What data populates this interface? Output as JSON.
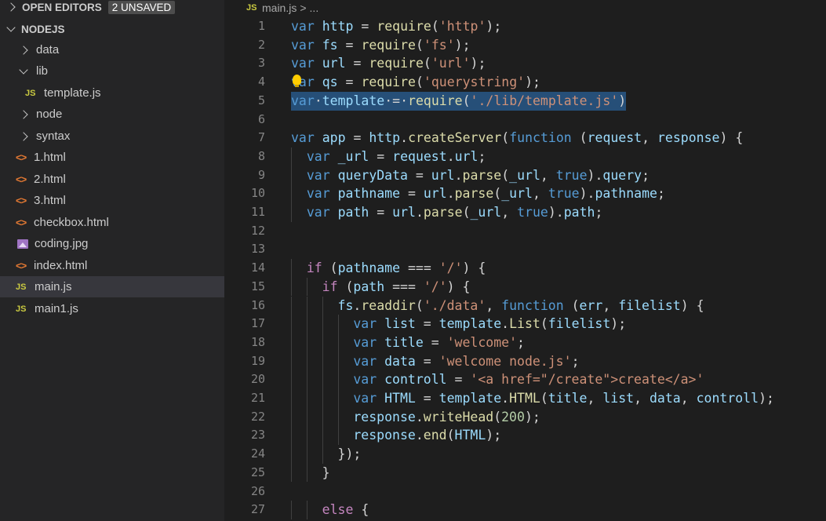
{
  "sidebar": {
    "open_editors": {
      "title": "OPEN EDITORS",
      "badge": "2 UNSAVED"
    },
    "folder": {
      "title": "NODEJS"
    },
    "items": [
      {
        "label": "data",
        "kind": "folder",
        "expanded": false
      },
      {
        "label": "lib",
        "kind": "folder",
        "expanded": true
      },
      {
        "label": "template.js",
        "kind": "js",
        "icon": "JS"
      },
      {
        "label": "node",
        "kind": "folder",
        "expanded": false
      },
      {
        "label": "syntax",
        "kind": "folder",
        "expanded": false
      },
      {
        "label": "1.html",
        "kind": "html",
        "icon": "<>"
      },
      {
        "label": "2.html",
        "kind": "html",
        "icon": "<>"
      },
      {
        "label": "3.html",
        "kind": "html",
        "icon": "<>"
      },
      {
        "label": "checkbox.html",
        "kind": "html",
        "icon": "<>"
      },
      {
        "label": "coding.jpg",
        "kind": "image"
      },
      {
        "label": "index.html",
        "kind": "html",
        "icon": "<>"
      },
      {
        "label": "main.js",
        "kind": "js",
        "icon": "JS",
        "selected": true
      },
      {
        "label": "main1.js",
        "kind": "js",
        "icon": "JS"
      }
    ]
  },
  "breadcrumb": {
    "icon": "JS",
    "file": "main.js",
    "separator": ">",
    "rest": "..."
  },
  "editor": {
    "lines": [
      {
        "n": "1",
        "tokens": [
          [
            "kw",
            "var"
          ],
          [
            "op",
            " "
          ],
          [
            "var",
            "http"
          ],
          [
            "op",
            " = "
          ],
          [
            "fn",
            "require"
          ],
          [
            "op",
            "("
          ],
          [
            "str",
            "'http'"
          ],
          [
            "op",
            ");"
          ]
        ]
      },
      {
        "n": "2",
        "tokens": [
          [
            "kw",
            "var"
          ],
          [
            "op",
            " "
          ],
          [
            "var",
            "fs"
          ],
          [
            "op",
            " = "
          ],
          [
            "fn",
            "require"
          ],
          [
            "op",
            "("
          ],
          [
            "str",
            "'fs'"
          ],
          [
            "op",
            ");"
          ]
        ]
      },
      {
        "n": "3",
        "tokens": [
          [
            "kw",
            "var"
          ],
          [
            "op",
            " "
          ],
          [
            "var",
            "url"
          ],
          [
            "op",
            " = "
          ],
          [
            "fn",
            "require"
          ],
          [
            "op",
            "("
          ],
          [
            "str",
            "'url'"
          ],
          [
            "op",
            ");"
          ]
        ]
      },
      {
        "n": "4",
        "tokens": [
          [
            "kw",
            "var"
          ],
          [
            "op",
            " "
          ],
          [
            "var",
            "qs"
          ],
          [
            "op",
            " = "
          ],
          [
            "fn",
            "require"
          ],
          [
            "op",
            "("
          ],
          [
            "str",
            "'querystring'"
          ],
          [
            "op",
            ");"
          ]
        ],
        "bulb": true
      },
      {
        "n": "5",
        "tokens": [
          [
            "kw",
            "var"
          ],
          [
            "op",
            "·"
          ],
          [
            "var",
            "template"
          ],
          [
            "op",
            "·=·"
          ],
          [
            "fn",
            "require"
          ],
          [
            "op",
            "("
          ],
          [
            "str",
            "'./lib/template.js'"
          ],
          [
            "op",
            ")"
          ]
        ],
        "selected": true
      },
      {
        "n": "6",
        "tokens": []
      },
      {
        "n": "7",
        "tokens": [
          [
            "kw",
            "var"
          ],
          [
            "op",
            " "
          ],
          [
            "var",
            "app"
          ],
          [
            "op",
            " = "
          ],
          [
            "var",
            "http"
          ],
          [
            "op",
            "."
          ],
          [
            "fn",
            "createServer"
          ],
          [
            "op",
            "("
          ],
          [
            "kw",
            "function"
          ],
          [
            "op",
            " ("
          ],
          [
            "var",
            "request"
          ],
          [
            "op",
            ", "
          ],
          [
            "var",
            "response"
          ],
          [
            "op",
            ") {"
          ]
        ]
      },
      {
        "n": "8",
        "indent": 1,
        "tokens": [
          [
            "kw",
            "var"
          ],
          [
            "op",
            " "
          ],
          [
            "var",
            "_url"
          ],
          [
            "op",
            " = "
          ],
          [
            "var",
            "request"
          ],
          [
            "op",
            "."
          ],
          [
            "var",
            "url"
          ],
          [
            "op",
            ";"
          ]
        ]
      },
      {
        "n": "9",
        "indent": 1,
        "tokens": [
          [
            "kw",
            "var"
          ],
          [
            "op",
            " "
          ],
          [
            "var",
            "queryData"
          ],
          [
            "op",
            " = "
          ],
          [
            "var",
            "url"
          ],
          [
            "op",
            "."
          ],
          [
            "fn",
            "parse"
          ],
          [
            "op",
            "("
          ],
          [
            "var",
            "_url"
          ],
          [
            "op",
            ", "
          ],
          [
            "kw",
            "true"
          ],
          [
            "op",
            ")."
          ],
          [
            "var",
            "query"
          ],
          [
            "op",
            ";"
          ]
        ]
      },
      {
        "n": "10",
        "indent": 1,
        "tokens": [
          [
            "kw",
            "var"
          ],
          [
            "op",
            " "
          ],
          [
            "var",
            "pathname"
          ],
          [
            "op",
            " = "
          ],
          [
            "var",
            "url"
          ],
          [
            "op",
            "."
          ],
          [
            "fn",
            "parse"
          ],
          [
            "op",
            "("
          ],
          [
            "var",
            "_url"
          ],
          [
            "op",
            ", "
          ],
          [
            "kw",
            "true"
          ],
          [
            "op",
            ")."
          ],
          [
            "var",
            "pathname"
          ],
          [
            "op",
            ";"
          ]
        ]
      },
      {
        "n": "11",
        "indent": 1,
        "tokens": [
          [
            "kw",
            "var"
          ],
          [
            "op",
            " "
          ],
          [
            "var",
            "path"
          ],
          [
            "op",
            " = "
          ],
          [
            "var",
            "url"
          ],
          [
            "op",
            "."
          ],
          [
            "fn",
            "parse"
          ],
          [
            "op",
            "("
          ],
          [
            "var",
            "_url"
          ],
          [
            "op",
            ", "
          ],
          [
            "kw",
            "true"
          ],
          [
            "op",
            ")."
          ],
          [
            "var",
            "path"
          ],
          [
            "op",
            ";"
          ]
        ]
      },
      {
        "n": "12",
        "tokens": []
      },
      {
        "n": "13",
        "tokens": []
      },
      {
        "n": "14",
        "indent": 1,
        "tokens": [
          [
            "ctl",
            "if"
          ],
          [
            "op",
            " ("
          ],
          [
            "var",
            "pathname"
          ],
          [
            "op",
            " === "
          ],
          [
            "str",
            "'/'"
          ],
          [
            "op",
            ") {"
          ]
        ]
      },
      {
        "n": "15",
        "indent": 2,
        "tokens": [
          [
            "ctl",
            "if"
          ],
          [
            "op",
            " ("
          ],
          [
            "var",
            "path"
          ],
          [
            "op",
            " === "
          ],
          [
            "str",
            "'/'"
          ],
          [
            "op",
            ") {"
          ]
        ]
      },
      {
        "n": "16",
        "indent": 3,
        "tokens": [
          [
            "var",
            "fs"
          ],
          [
            "op",
            "."
          ],
          [
            "fn",
            "readdir"
          ],
          [
            "op",
            "("
          ],
          [
            "str",
            "'./data'"
          ],
          [
            "op",
            ", "
          ],
          [
            "kw",
            "function"
          ],
          [
            "op",
            " ("
          ],
          [
            "var",
            "err"
          ],
          [
            "op",
            ", "
          ],
          [
            "var",
            "filelist"
          ],
          [
            "op",
            ") {"
          ]
        ]
      },
      {
        "n": "17",
        "indent": 4,
        "tokens": [
          [
            "kw",
            "var"
          ],
          [
            "op",
            " "
          ],
          [
            "var",
            "list"
          ],
          [
            "op",
            " = "
          ],
          [
            "var",
            "template"
          ],
          [
            "op",
            "."
          ],
          [
            "fn",
            "List"
          ],
          [
            "op",
            "("
          ],
          [
            "var",
            "filelist"
          ],
          [
            "op",
            ");"
          ]
        ]
      },
      {
        "n": "18",
        "indent": 4,
        "tokens": [
          [
            "kw",
            "var"
          ],
          [
            "op",
            " "
          ],
          [
            "var",
            "title"
          ],
          [
            "op",
            " = "
          ],
          [
            "str",
            "'welcome'"
          ],
          [
            "op",
            ";"
          ]
        ]
      },
      {
        "n": "19",
        "indent": 4,
        "tokens": [
          [
            "kw",
            "var"
          ],
          [
            "op",
            " "
          ],
          [
            "var",
            "data"
          ],
          [
            "op",
            " = "
          ],
          [
            "str",
            "'welcome node.js'"
          ],
          [
            "op",
            ";"
          ]
        ]
      },
      {
        "n": "20",
        "indent": 4,
        "tokens": [
          [
            "kw",
            "var"
          ],
          [
            "op",
            " "
          ],
          [
            "var",
            "controll"
          ],
          [
            "op",
            " = "
          ],
          [
            "str",
            "'<a href=\"/create\">create</a>'"
          ]
        ]
      },
      {
        "n": "21",
        "indent": 4,
        "tokens": [
          [
            "kw",
            "var"
          ],
          [
            "op",
            " "
          ],
          [
            "var",
            "HTML"
          ],
          [
            "op",
            " = "
          ],
          [
            "var",
            "template"
          ],
          [
            "op",
            "."
          ],
          [
            "fn",
            "HTML"
          ],
          [
            "op",
            "("
          ],
          [
            "var",
            "title"
          ],
          [
            "op",
            ", "
          ],
          [
            "var",
            "list"
          ],
          [
            "op",
            ", "
          ],
          [
            "var",
            "data"
          ],
          [
            "op",
            ", "
          ],
          [
            "var",
            "controll"
          ],
          [
            "op",
            ");"
          ]
        ]
      },
      {
        "n": "22",
        "indent": 4,
        "tokens": [
          [
            "var",
            "response"
          ],
          [
            "op",
            "."
          ],
          [
            "fn",
            "writeHead"
          ],
          [
            "op",
            "("
          ],
          [
            "num",
            "200"
          ],
          [
            "op",
            ");"
          ]
        ]
      },
      {
        "n": "23",
        "indent": 4,
        "tokens": [
          [
            "var",
            "response"
          ],
          [
            "op",
            "."
          ],
          [
            "fn",
            "end"
          ],
          [
            "op",
            "("
          ],
          [
            "var",
            "HTML"
          ],
          [
            "op",
            ");"
          ]
        ]
      },
      {
        "n": "24",
        "indent": 3,
        "tokens": [
          [
            "op",
            "});"
          ]
        ]
      },
      {
        "n": "25",
        "indent": 2,
        "tokens": [
          [
            "op",
            "}"
          ]
        ]
      },
      {
        "n": "26",
        "tokens": []
      },
      {
        "n": "27",
        "indent": 2,
        "tokens": [
          [
            "ctl",
            "else"
          ],
          [
            "op",
            " {"
          ]
        ]
      }
    ]
  },
  "colors": {
    "keyword": "#569cd6",
    "control": "#c586c0",
    "string": "#ce9178",
    "function": "#dcdcaa",
    "variable": "#9cdcfe",
    "number": "#b5cea8",
    "selection": "#264f78",
    "sidebar_bg": "#252526",
    "editor_bg": "#1e1e1e"
  }
}
